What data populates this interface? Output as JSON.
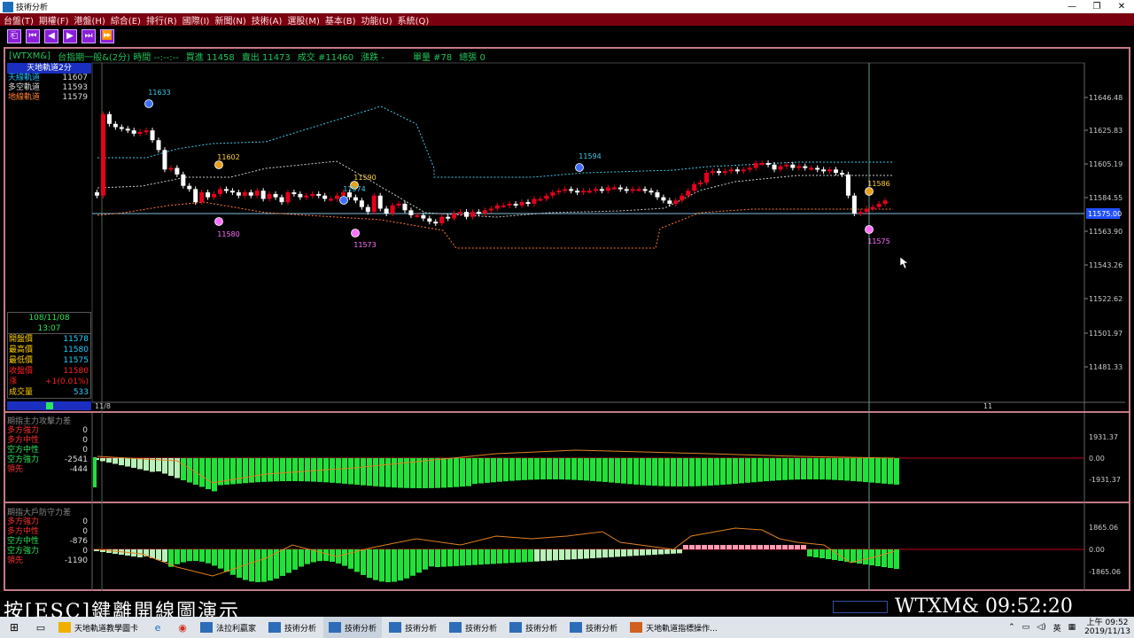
{
  "window": {
    "title": "技術分析",
    "controls": [
      "—",
      "❐",
      "✕"
    ]
  },
  "menu": [
    "台盤(T)",
    "期權(F)",
    "港盤(H)",
    "綜合(E)",
    "排行(R)",
    "國際(I)",
    "新聞(N)",
    "技術(A)",
    "選股(M)",
    "基本(B)",
    "功能(U)",
    "系統(Q)"
  ],
  "toolbar": {
    "buttons": [
      "⎗",
      "⏮",
      "◀",
      "▶",
      "⏭",
      "⏩"
    ]
  },
  "infobar": {
    "symbol": "[WTXM&]",
    "name": "台指期一般&(2分) 時間 --:--:--",
    "bid": "買進 11458",
    "ask": "賣出 11473",
    "deal": "成交 #11460",
    "change": "漲跌 -",
    "volume": "單量 #78",
    "total": "總張 0"
  },
  "left_panel": {
    "title": "天地軌道2分",
    "rows": [
      {
        "label": "天線軌道",
        "value": "11607",
        "color": "#20c0ff"
      },
      {
        "label": "多空軌道",
        "value": "11593",
        "color": "#dddddd"
      },
      {
        "label": "地線軌道",
        "value": "11579",
        "color": "#ff8030"
      }
    ]
  },
  "quote_panel": {
    "date": "108/11/08",
    "time": "13:07",
    "rows": [
      {
        "label": "開盤價",
        "value": "11578",
        "lc": "#ffd000",
        "vc": "#20d0ff"
      },
      {
        "label": "最高價",
        "value": "11580",
        "lc": "#ffd000",
        "vc": "#20d0ff"
      },
      {
        "label": "最低價",
        "value": "11575",
        "lc": "#ffd000",
        "vc": "#20d0ff"
      },
      {
        "label": "收盤價",
        "value": "11580",
        "lc": "#ff2020",
        "vc": "#ff2020"
      },
      {
        "label": "漲",
        "value": "+1(0.01%)",
        "lc": "#ff2020",
        "vc": "#ff2020"
      },
      {
        "label": "成交量",
        "value": "533",
        "lc": "#ffd000",
        "vc": "#20d0ff"
      }
    ]
  },
  "main_chart": {
    "y_ticks": [
      "11646.48",
      "11625.83",
      "11605.19",
      "11584.55",
      "11563.90",
      "11543.26",
      "11522.62",
      "11501.97",
      "11481.33"
    ],
    "current_price": "11575.00",
    "x_labels": [
      "11/8",
      "11"
    ],
    "annotations": [
      "11633",
      "11602",
      "11580",
      "11590",
      "11574",
      "11573",
      "11594",
      "11586",
      "11575"
    ]
  },
  "sub1": {
    "title": "期指主力攻擊力差",
    "rows": [
      {
        "label": "多方強力",
        "value": "0",
        "lc": "#ff3030"
      },
      {
        "label": "多方中性",
        "value": "0",
        "lc": "#ff3030"
      },
      {
        "label": "空方中性",
        "value": "0",
        "lc": "#2ae85a"
      },
      {
        "label": "空方強力",
        "value": "-2541",
        "lc": "#2ae85a"
      },
      {
        "label": "領先",
        "value": "-444",
        "lc": "#ff3030"
      }
    ],
    "y_ticks": [
      "1931.37",
      "0.00",
      "-1931.37"
    ]
  },
  "sub2": {
    "title": "期指大戶防守力差",
    "rows": [
      {
        "label": "多方強力",
        "value": "0",
        "lc": "#ff3030"
      },
      {
        "label": "多方中性",
        "value": "0",
        "lc": "#ff3030"
      },
      {
        "label": "空方中性",
        "value": "-876",
        "lc": "#2ae85a"
      },
      {
        "label": "空方強力",
        "value": "0",
        "lc": "#2ae85a"
      },
      {
        "label": "領先",
        "value": "-1190",
        "lc": "#ff3030"
      }
    ],
    "y_ticks": [
      "1865.06",
      "0.00",
      "-1865.06"
    ]
  },
  "banner": {
    "text": "按[ESC]鍵離開線圖演示",
    "ticker": "WTXM&  09:52:20"
  },
  "taskbar": {
    "apps": [
      "天地軌道教學圖卡",
      "法拉利贏家",
      "技術分析",
      "技術分析",
      "技術分析",
      "技術分析",
      "技術分析",
      "技術分析",
      "天地軌道指標操作..."
    ],
    "ime": "英",
    "time": "上午 09:52",
    "date": "2019/11/13"
  },
  "colors": {
    "up": "#e8001c",
    "down": "#ffffff",
    "bar_green": "#22e03a",
    "bar_light": "#b8f0b8",
    "frame": "#c47a86"
  }
}
